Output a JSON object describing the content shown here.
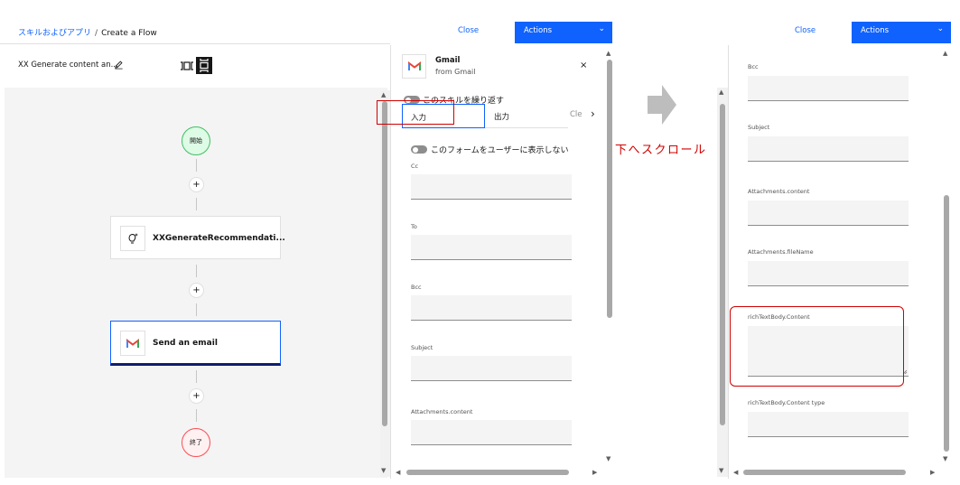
{
  "breadcrumb": {
    "parent": "スキルおよびアプリ",
    "separator": "/",
    "current": "Create a Flow"
  },
  "flow": {
    "name": "XX Generate content an..."
  },
  "canvas": {
    "start_label": "開始",
    "end_label": "終了",
    "add_symbol": "+",
    "skill_node_label": "XXGenerateRecommendati...",
    "email_node_label": "Send an email"
  },
  "header": {
    "close_label": "Close",
    "actions_label": "Actions",
    "actions_chevron": "⌄"
  },
  "panel": {
    "app_name": "Gmail",
    "app_source": "from Gmail",
    "close_symbol": "×",
    "repeat_toggle_label": "このスキルを繰り返す",
    "tabs": [
      "入力",
      "出力",
      "Cle"
    ],
    "tab_next": "›",
    "form_toggle_label": "このフォームをユーザーに表示しない",
    "fields": [
      "Cc",
      "To",
      "Bcc",
      "Subject",
      "Attachments.content"
    ]
  },
  "panel2": {
    "fields": [
      "Bcc",
      "Subject",
      "Attachments.content",
      "Attachments.fileName",
      "richTextBody.Content",
      "richTextBody.Content type"
    ]
  },
  "scroll": {
    "up": "▲",
    "down": "▼",
    "left": "◀",
    "right": "▶"
  },
  "annotation": {
    "scroll_text": "下へスクロール"
  },
  "colors": {
    "accent": "#0f62fe",
    "annotation": "#d00000",
    "start": "#42be65",
    "end": "#fa4d56"
  }
}
